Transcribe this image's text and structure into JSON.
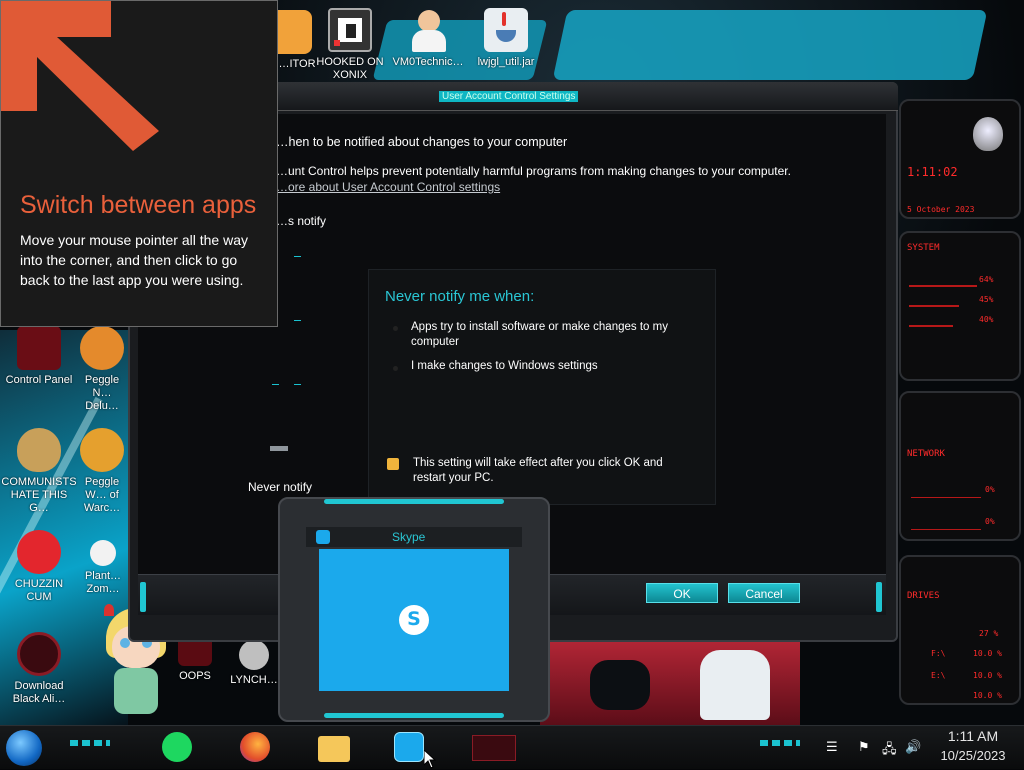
{
  "desktop": {
    "icons": [
      {
        "label": "…ITOR",
        "icon": "orange-app-icon"
      },
      {
        "label": "HOOKED ON XONIX",
        "icon": "xonix-game-icon"
      },
      {
        "label": "VM0Technic…",
        "icon": "doctor-avatar-icon"
      },
      {
        "label": "lwjgl_util.jar",
        "icon": "java-icon"
      },
      {
        "label": "Control Panel",
        "icon": "control-panel-icon"
      },
      {
        "label": "Peggle N… Delu…",
        "icon": "peggle-icon"
      },
      {
        "label": "COMMUNISTS HATE THIS G…",
        "icon": "money-bag-icon"
      },
      {
        "label": "Peggle W… of Warc…",
        "icon": "peggle-warcraft-icon"
      },
      {
        "label": "CHUZZIN CUM",
        "icon": "chuzzle-icon"
      },
      {
        "label": "Plant… Zom…",
        "icon": "plants-zombies-icon"
      },
      {
        "label": "Download Black Ali…",
        "icon": "alienware-icon"
      },
      {
        "label": "OOPS",
        "icon": "oops-app-icon"
      },
      {
        "label": "LYNCH…",
        "icon": "lynch-app-icon"
      }
    ]
  },
  "uac": {
    "title": "User Account Control Settings",
    "heading": "…hen to be notified about changes to your computer",
    "description": "…unt Control helps prevent potentially harmful programs from making changes to your computer.",
    "link": "…ore about User Account Control settings",
    "top_label": "…s notify",
    "bottom_label": "Never notify",
    "infobox": {
      "title": "Never notify me when:",
      "bullet1": "Apps try to install software or make changes to my computer",
      "bullet2": "I make changes to Windows settings",
      "note": "This setting will take effect after you click OK and restart your PC."
    },
    "ok_label": "OK",
    "cancel_label": "Cancel"
  },
  "tip": {
    "title": "Switch between apps",
    "body": "Move your mouse pointer all the way into the corner, and then click to go back to the last app you were using."
  },
  "skype": {
    "title": "Skype"
  },
  "widget": {
    "clock": "1:11:02",
    "date": "5 October 2023",
    "system_label": "SYSTEM",
    "cpu": "64%",
    "mem": "45%",
    "disk": "40%",
    "network_label": "NETWORK",
    "net_up": "0%",
    "net_down": "0%",
    "drives_label": "DRIVES",
    "c_drive": "27 %",
    "d_drive": "10.0 %",
    "f_drive_label": "F:\\",
    "f_drive": "10.0 %",
    "e_drive_label": "E:\\",
    "e_drive": "10.0 %"
  },
  "taskbar": {
    "time": "1:11 AM",
    "date": "10/25/2023",
    "items": [
      "start-orb",
      "spotify",
      "firefox",
      "file-explorer",
      "skype",
      "alienware"
    ]
  },
  "colors": {
    "accent": "#19c3d0",
    "tip_title": "#e9603b",
    "skype_blue": "#1ba9ec",
    "widget_red": "#ff2b2b"
  }
}
